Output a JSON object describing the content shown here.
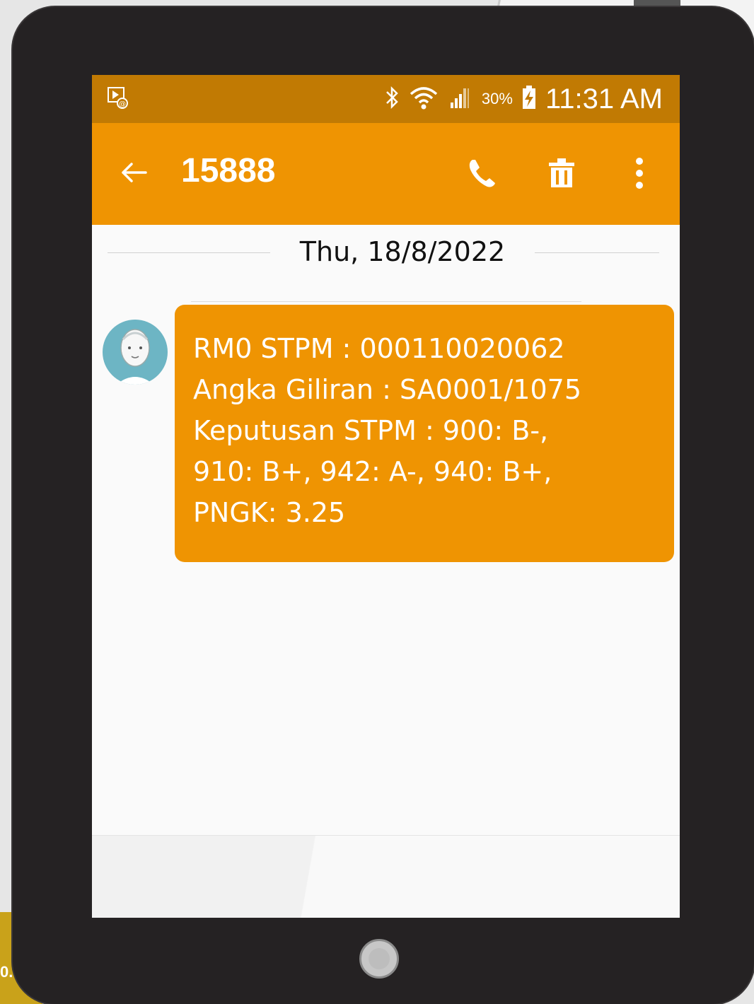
{
  "status_bar": {
    "notification_icon": "email-notification-icon",
    "bluetooth_icon": "bluetooth-icon",
    "wifi_icon": "wifi-icon",
    "signal_icon": "signal-icon",
    "battery_percent": "30%",
    "battery_icon": "battery-charging-icon",
    "time": "11:31 AM"
  },
  "app_bar": {
    "back_icon": "back-arrow-icon",
    "title": "15888",
    "call_icon": "phone-icon",
    "delete_icon": "trash-icon",
    "more_icon": "more-vert-icon"
  },
  "conversation": {
    "date": "Thu, 18/8/2022",
    "messages": [
      {
        "sender_avatar": "contact-avatar-icon",
        "lines": [
          "RM0 STPM : 000110020062",
          "Angka Giliran : SA0001/1075",
          "Keputusan STPM : 900: B-,",
          "910: B+, 942: A-, 940: B+,",
          "PNGK: 3.25"
        ]
      }
    ]
  },
  "background": {
    "badge_text": "0."
  },
  "colors": {
    "status_bar": "#c17a03",
    "app_bar": "#ef9402",
    "bubble": "#ef9402",
    "device_frame": "#252223",
    "screen_bg": "#fafafa"
  }
}
